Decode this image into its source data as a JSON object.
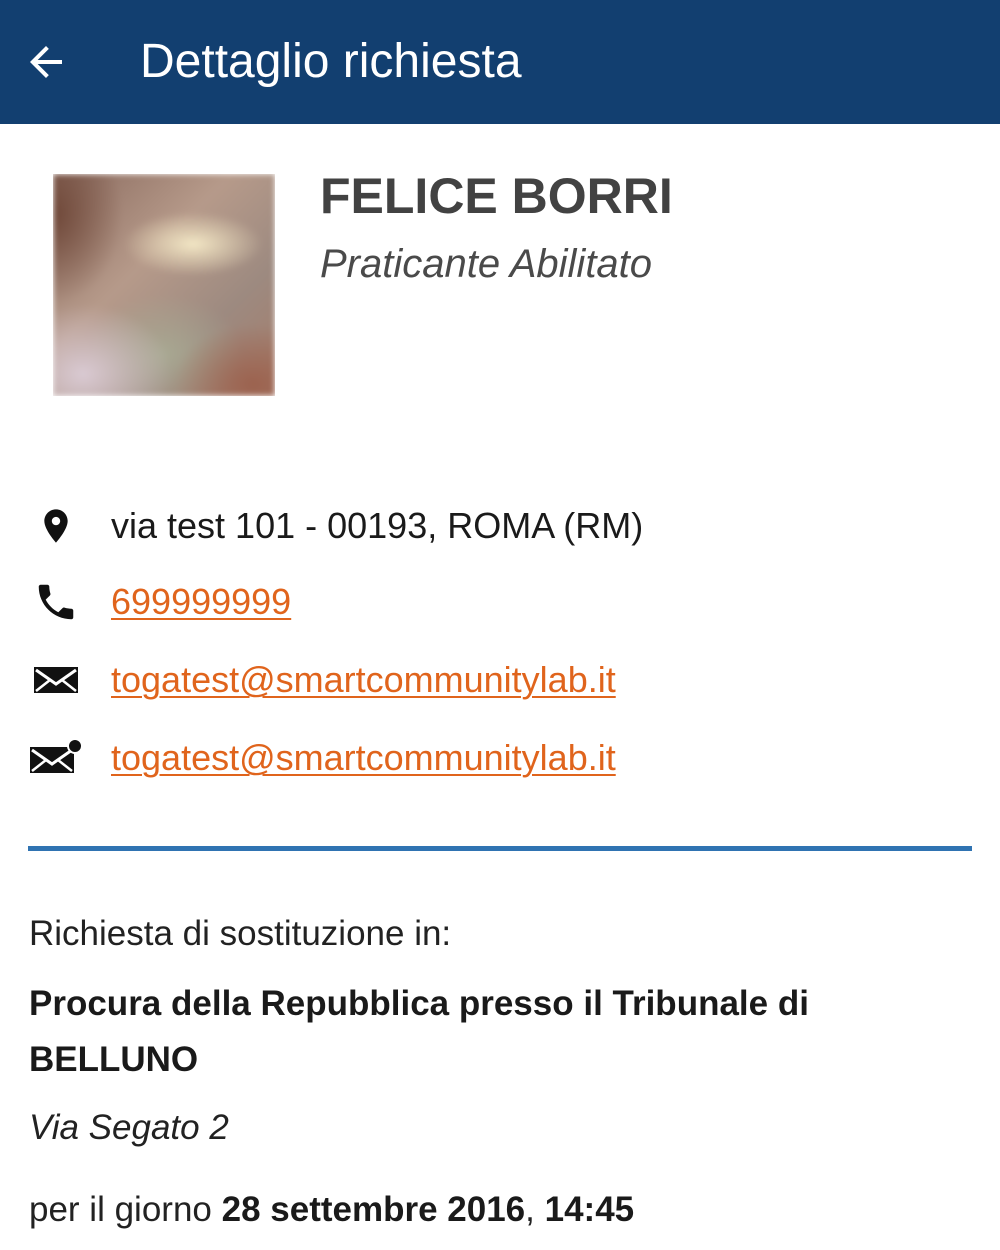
{
  "appbar": {
    "title": "Dettaglio richiesta",
    "back_icon": "arrow-left-icon",
    "color": "#123f70"
  },
  "profile": {
    "name": "FELICE BORRI",
    "role": "Praticante Abilitato"
  },
  "contacts": {
    "address": {
      "icon": "location-pin-icon",
      "text": "via test 101 - 00193, ROMA (RM)"
    },
    "phone": {
      "icon": "phone-icon",
      "text": "699999999"
    },
    "email": {
      "icon": "envelope-icon",
      "text": "togatest@smartcommunitylab.it"
    },
    "pec": {
      "icon": "envelope-dot-icon",
      "text": "togatest@smartcommunitylab.it"
    },
    "link_color": "#e0641c"
  },
  "request": {
    "intro": "Richiesta di sostituzione in:",
    "office": "Procura della Repubblica presso il Tribunale di BELLUNO",
    "address": "Via Segato 2",
    "date_prefix": "per il giorno ",
    "date": "28 settembre 2016",
    "date_sep": ", ",
    "time": "14:45"
  },
  "divider_color": "#2f73b2"
}
